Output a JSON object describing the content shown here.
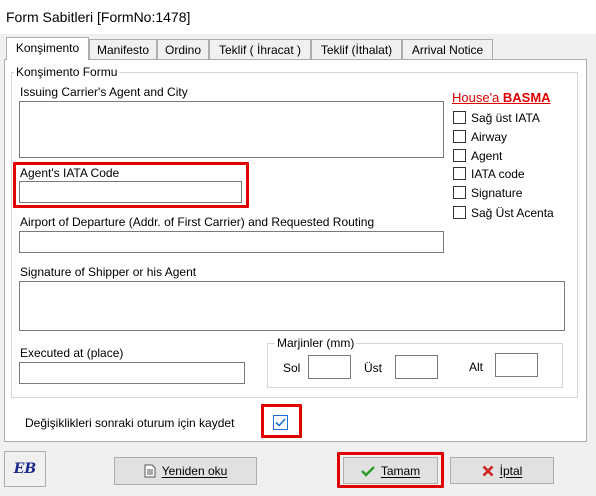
{
  "window": {
    "title": "Form Sabitleri [FormNo:1478]"
  },
  "tabs": [
    {
      "label": "Konşimento"
    },
    {
      "label": "Manifesto"
    },
    {
      "label": "Ordino"
    },
    {
      "label": "Teklif ( İhracat )"
    },
    {
      "label": "Teklif (İthalat)"
    },
    {
      "label": "Arrival Notice"
    }
  ],
  "form": {
    "group_title": "Konşimento Formu",
    "issuing_carrier_label": "Issuing Carrier's Agent and City",
    "issuing_carrier_value": "",
    "agent_iata_label": "Agent's IATA Code",
    "agent_iata_value": "",
    "airport_label": "Airport of Departure (Addr. of First Carrier) and Requested Routing",
    "airport_value": "",
    "signature_label": "Signature of Shipper or his Agent",
    "signature_value": "",
    "executed_label": "Executed at (place)",
    "executed_value": "",
    "margins": {
      "title": "Marjinler (mm)",
      "sol_label": "Sol",
      "sol_value": "",
      "ust_label": "Üst",
      "ust_value": "",
      "alt_label": "Alt",
      "alt_value": ""
    },
    "house": {
      "prefix": "House'a ",
      "bold": "BASMA",
      "options": [
        {
          "label": "Sağ üst IATA",
          "checked": false
        },
        {
          "label": "Airway",
          "checked": false
        },
        {
          "label": "Agent",
          "checked": false
        },
        {
          "label": "IATA code",
          "checked": false
        },
        {
          "label": "Signature",
          "checked": false
        },
        {
          "label": "Sağ Üst Acenta",
          "checked": false
        }
      ]
    },
    "save_changes_label": "Değişiklikleri sonraki oturum için kaydet",
    "save_changes_checked": true
  },
  "buttons": {
    "logo_text": "EB",
    "reload_label": "Yeniden oku",
    "ok_label": "Tamam",
    "cancel_label": "İptal"
  },
  "colors": {
    "highlight": "#e00000",
    "check": "#1a6fd6",
    "ok_icon": "#2a9a2a",
    "cancel_icon": "#d02020"
  }
}
